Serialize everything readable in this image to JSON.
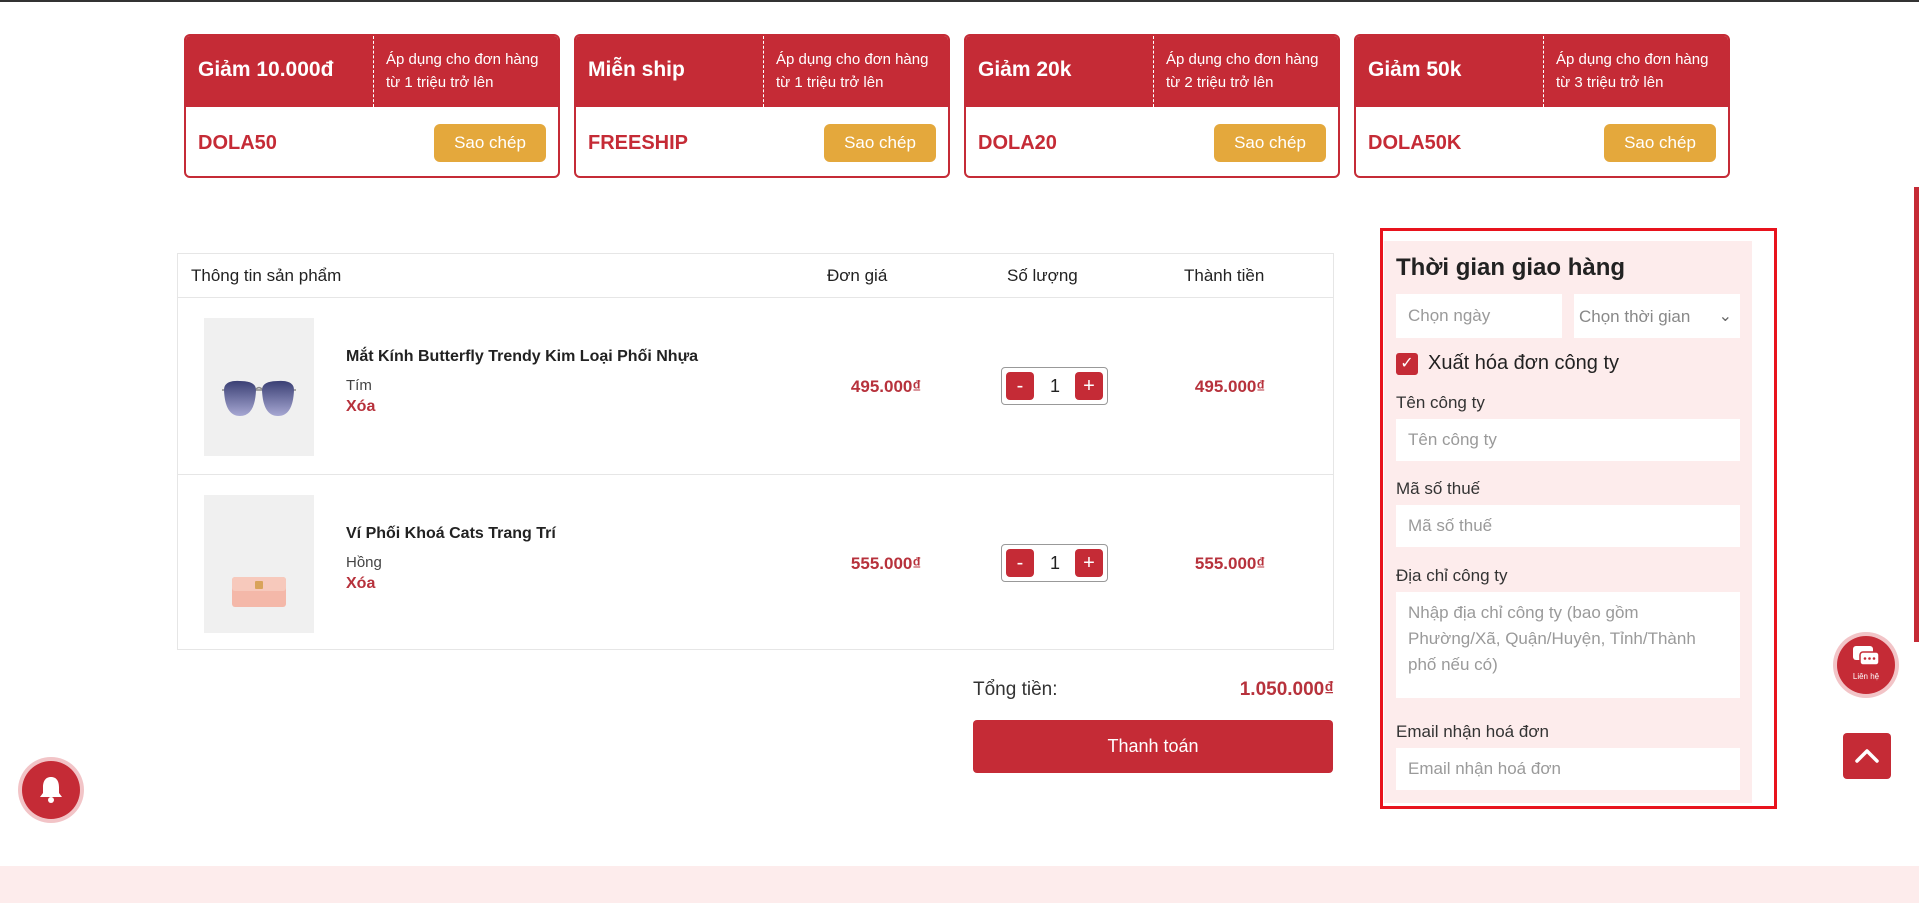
{
  "coupons": [
    {
      "title": "Giảm 10.000đ",
      "desc": "Áp dụng cho đơn hàng từ 1 triệu trở lên",
      "code": "DOLA50",
      "button": "Sao chép"
    },
    {
      "title": "Miễn ship",
      "desc": "Áp dụng cho đơn hàng từ 1 triệu trở lên",
      "code": "FREESHIP",
      "button": "Sao chép"
    },
    {
      "title": "Giảm 20k",
      "desc": "Áp dụng cho đơn hàng từ 2 triệu trở lên",
      "code": "DOLA20",
      "button": "Sao chép"
    },
    {
      "title": "Giảm 50k",
      "desc": "Áp dụng cho đơn hàng từ 3 triệu trở lên",
      "code": "DOLA50K",
      "button": "Sao chép"
    }
  ],
  "cart": {
    "headers": {
      "product": "Thông tin sản phẩm",
      "unit_price": "Đơn giá",
      "quantity": "Số lượng",
      "total": "Thành tiền"
    },
    "items": [
      {
        "name": "Mắt Kính Butterfly Trendy Kim Loại Phối Nhựa",
        "variant": "Tím",
        "remove": "Xóa",
        "price": "495.000₫",
        "qty": "1",
        "total": "495.000₫",
        "minus": "-",
        "plus": "+"
      },
      {
        "name": "Ví Phối Khoá Cats Trang Trí",
        "variant": "Hồng",
        "remove": "Xóa",
        "price": "555.000₫",
        "qty": "1",
        "total": "555.000₫",
        "minus": "-",
        "plus": "+"
      }
    ],
    "summary_label": "Tổng tiền:",
    "summary_value": "1.050.000₫",
    "checkout": "Thanh toán"
  },
  "delivery": {
    "title": "Thời gian giao hàng",
    "date_placeholder": "Chọn ngày",
    "time_select": "Chọn thời gian",
    "invoice_checkbox": "Xuất hóa đơn công ty",
    "invoice_checked": true,
    "company_label": "Tên công ty",
    "company_placeholder": "Tên công ty",
    "tax_label": "Mã số thuế",
    "tax_placeholder": "Mã số thuế",
    "address_label": "Địa chỉ công ty",
    "address_placeholder": "Nhập địa chỉ công ty (bao gồm Phường/Xã, Quận/Huyện, Tỉnh/Thành phố nếu có)",
    "email_label": "Email nhận hoá đơn",
    "email_placeholder": "Email nhận hoá đơn"
  },
  "floating": {
    "chat_label": "Liên hệ",
    "icons": {
      "bell": "bell-icon",
      "chat": "chat-icon",
      "up": "chevron-up-icon"
    }
  },
  "colors": {
    "brand": "#c52b36",
    "accent": "#e4a83c",
    "panel_bg": "#fdecec",
    "highlight": "#e8131d"
  }
}
